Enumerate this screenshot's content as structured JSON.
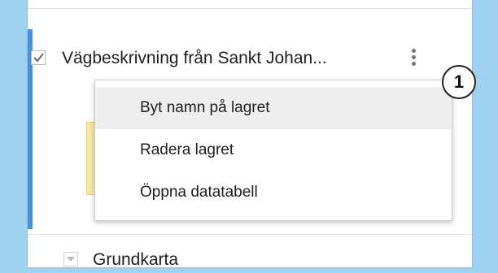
{
  "layer": {
    "title": "Vägbeskrivning från Sankt Johan...",
    "checked": true,
    "options_icon": "kebab-menu-icon"
  },
  "callout": {
    "number": "1"
  },
  "context_menu": {
    "items": [
      {
        "label": "Byt namn på lagret"
      },
      {
        "label": "Radera lagret"
      },
      {
        "label": "Öppna datatabell"
      }
    ]
  },
  "basemap": {
    "title": "Grundkarta",
    "expand_icon": "dropdown-arrow-icon"
  },
  "colors": {
    "background": "#9fd2f2",
    "active_layer_strip": "#4a8fe0",
    "layer_swatch": "#fbe7a6",
    "menu_hover": "#eeeeee"
  }
}
